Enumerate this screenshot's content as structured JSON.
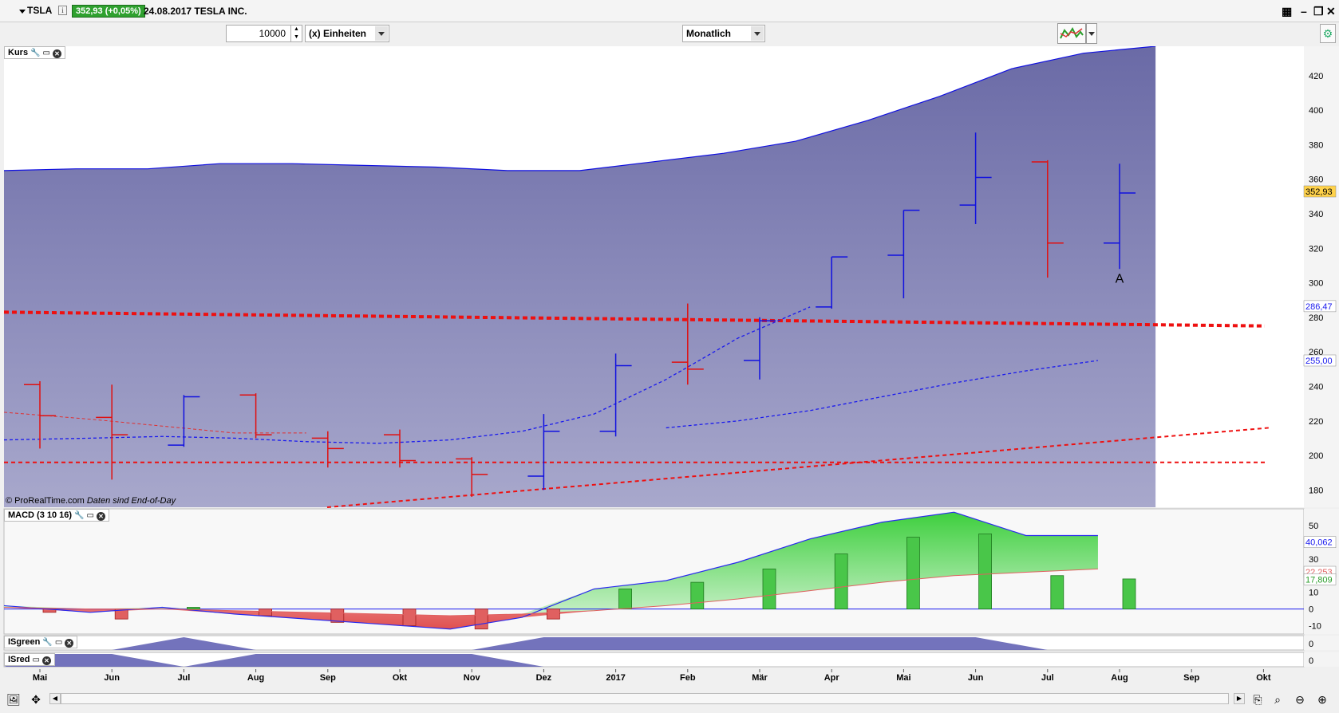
{
  "header": {
    "symbol": "TSLA",
    "price_badge": "352,93 (+0,05%)",
    "date_name": "24.08.2017 TESLA INC."
  },
  "toolbar": {
    "quantity": "10000",
    "unit_select": "(x) Einheiten",
    "period_select": "Monatlich"
  },
  "panels": {
    "price": {
      "label": "Kurs",
      "copyright": "© ProRealTime.com",
      "copyright_note": "Daten sind End-of-Day"
    },
    "macd": {
      "label": "MACD (3 10 16)"
    },
    "isgreen": {
      "label": "ISgreen"
    },
    "isred": {
      "label": "ISred"
    }
  },
  "colors": {
    "up": "#1010e0",
    "down": "#e01010",
    "cloud_top": "#6a6aa6",
    "cloud_bottom": "#a8a8cc",
    "macd_pos": "#49c649",
    "macd_neg": "#e06060",
    "price_badge": "#ffd24a"
  },
  "chart_data": {
    "type": "ohlc",
    "period": "monthly",
    "categories": [
      "Mai",
      "Jun",
      "Jul",
      "Aug",
      "Sep",
      "Okt",
      "Nov",
      "Dez",
      "2017",
      "Feb",
      "Mär",
      "Apr",
      "Mai",
      "Jun",
      "Jul",
      "Aug",
      "Sep",
      "Okt"
    ],
    "y_ticks": [
      180,
      200,
      220,
      240,
      260,
      280,
      300,
      320,
      340,
      360,
      380,
      400,
      420
    ],
    "ylim": [
      170,
      437
    ],
    "bars": [
      {
        "o": 241,
        "h": 243,
        "l": 204,
        "c": 223
      },
      {
        "o": 222,
        "h": 241,
        "l": 186,
        "c": 212
      },
      {
        "o": 206,
        "h": 235,
        "l": 205,
        "c": 234
      },
      {
        "o": 235,
        "h": 236,
        "l": 210,
        "c": 212
      },
      {
        "o": 210,
        "h": 214,
        "l": 193,
        "c": 204
      },
      {
        "o": 212,
        "h": 215,
        "l": 193,
        "c": 197
      },
      {
        "o": 198,
        "h": 199,
        "l": 176,
        "c": 189
      },
      {
        "o": 188,
        "h": 224,
        "l": 180,
        "c": 214
      },
      {
        "o": 214,
        "h": 259,
        "l": 211,
        "c": 252
      },
      {
        "o": 254,
        "h": 288,
        "l": 241,
        "c": 250
      },
      {
        "o": 255,
        "h": 280,
        "l": 244,
        "c": 278
      },
      {
        "o": 286,
        "h": 315,
        "l": 285,
        "c": 315
      },
      {
        "o": 316,
        "h": 342,
        "l": 291,
        "c": 342
      },
      {
        "o": 345,
        "h": 387,
        "l": 334,
        "c": 361
      },
      {
        "o": 370,
        "h": 371,
        "l": 303,
        "c": 323
      },
      {
        "o": 323,
        "h": 369,
        "l": 308,
        "c": 352
      }
    ],
    "cloud_upper": [
      365,
      366,
      366,
      369,
      369,
      368,
      367,
      365,
      365,
      370,
      375,
      382,
      394,
      408,
      424,
      433,
      437
    ],
    "ma_fast": [
      209,
      210,
      211,
      210,
      208,
      207,
      209,
      214,
      224,
      244,
      268,
      286
    ],
    "ma_slow": [
      216,
      220,
      226,
      234,
      242,
      249,
      255
    ],
    "ma_red_thin": [
      225,
      221,
      217,
      213,
      213
    ],
    "annotation": "A",
    "last_labels": [
      "352,93",
      "286,47",
      "255,00"
    ],
    "macd": {
      "y_ticks": [
        50,
        40,
        30,
        20,
        10,
        0,
        -10
      ],
      "ylim": [
        -15,
        60
      ],
      "histogram": [
        -2,
        -6,
        1,
        -4,
        -8,
        -10,
        -12,
        -6,
        12,
        16,
        24,
        33,
        43,
        45,
        20,
        18
      ],
      "macd_line": [
        2,
        -2,
        1,
        -3,
        -6,
        -9,
        -12,
        -5,
        12,
        17,
        28,
        42,
        52,
        58,
        44,
        44
      ],
      "signal_line": [
        1,
        0,
        0,
        -1,
        -2,
        -3,
        -4,
        -3,
        -1,
        2,
        6,
        11,
        16,
        20,
        22,
        24
      ],
      "last_labels": [
        "40,062",
        "22,253",
        "17,809"
      ]
    },
    "indicator_zero": "0"
  }
}
